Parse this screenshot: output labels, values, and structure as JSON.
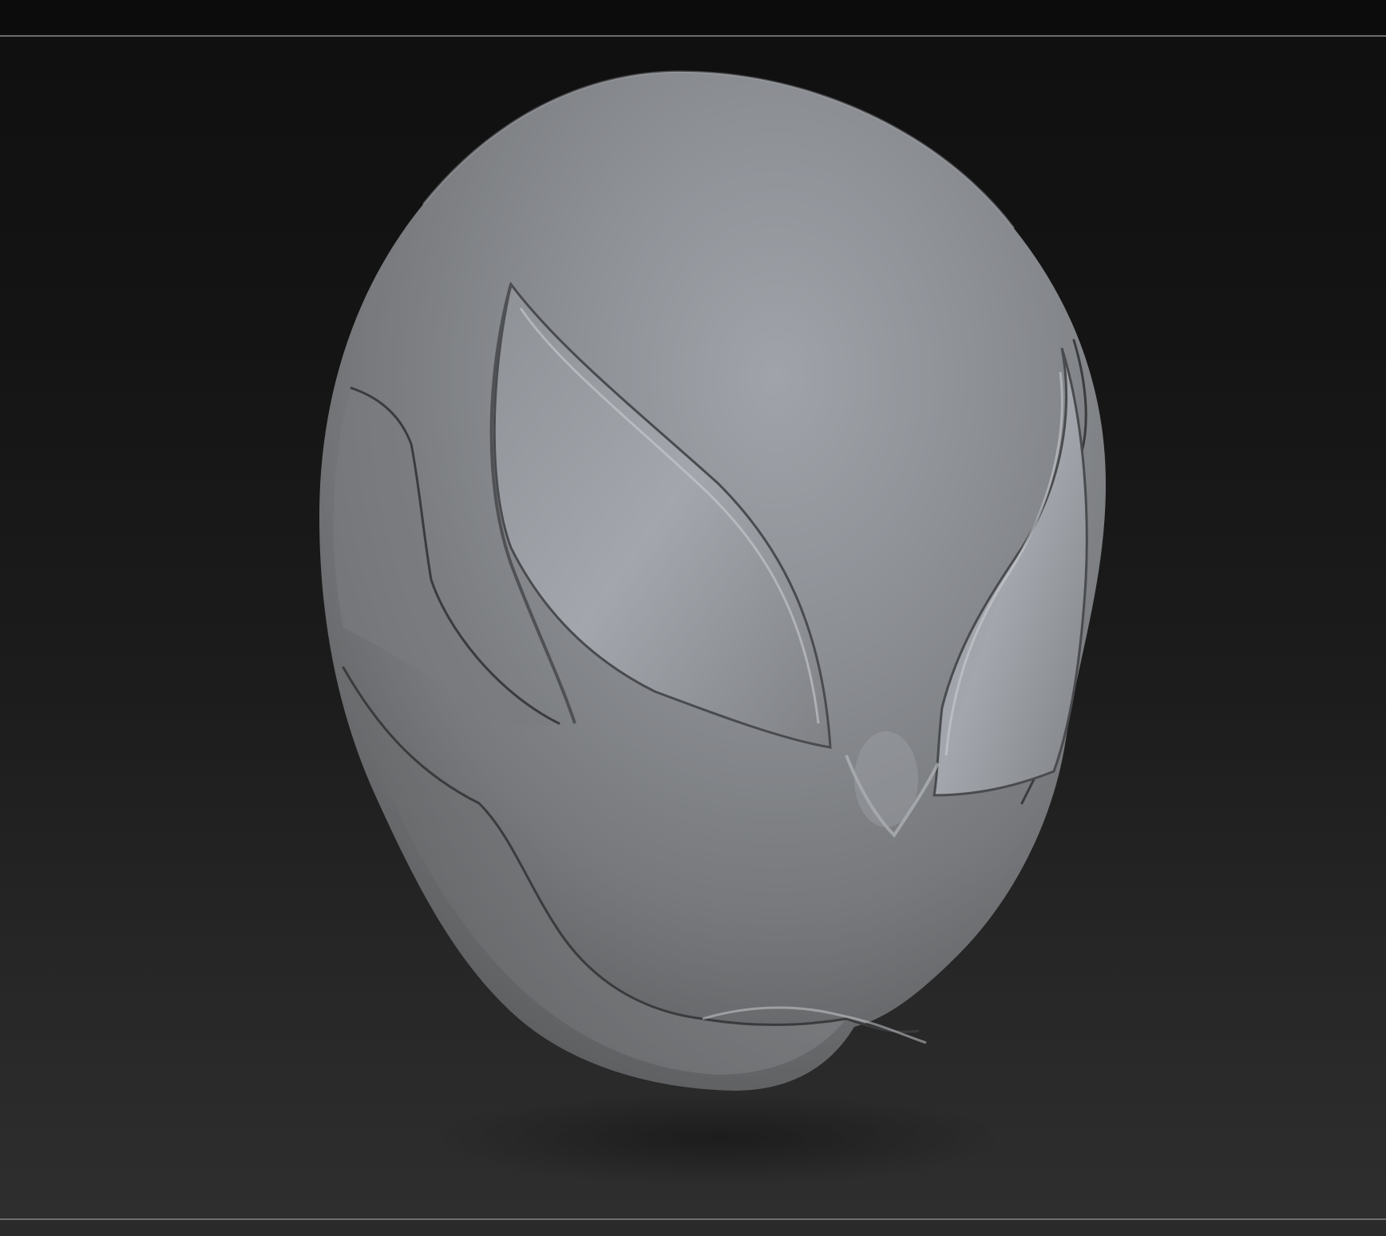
{
  "window": {
    "background": "#161616",
    "divider_color": "#6b6b6b"
  },
  "viewport": {
    "model": "sculpted-mask-head",
    "material_color": "#8a8c8f",
    "background_top": "#101010",
    "background_bottom": "#2e2e2e"
  }
}
